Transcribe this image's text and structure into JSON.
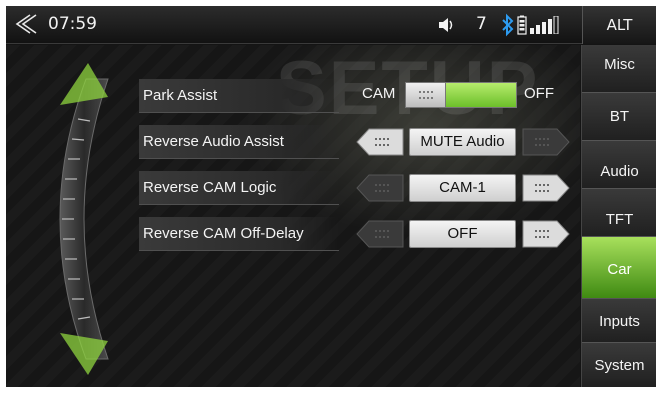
{
  "status_bar": {
    "clock": "07:59",
    "volume_level": "7",
    "alt_label": "ALT",
    "icons": [
      "back-icon",
      "volume-icon",
      "bluetooth-icon",
      "phone-battery-icon",
      "signal-strength-icon"
    ]
  },
  "main": {
    "watermark": "SETUP",
    "rows": [
      {
        "label": "Park Assist",
        "type": "toggle",
        "left_option": "CAM",
        "right_option": "OFF",
        "selected": "OFF"
      },
      {
        "label": "Reverse Audio Assist",
        "type": "selector",
        "value": "MUTE Audio",
        "prev_enabled": true,
        "next_enabled": false
      },
      {
        "label": "Reverse CAM Logic",
        "type": "selector",
        "value": "CAM-1",
        "prev_enabled": false,
        "next_enabled": true
      },
      {
        "label": "Reverse CAM Off-Delay",
        "type": "selector",
        "value": "OFF",
        "prev_enabled": false,
        "next_enabled": true
      }
    ]
  },
  "menu": {
    "items": [
      {
        "label": "Misc",
        "active": false
      },
      {
        "label": "BT",
        "active": false
      },
      {
        "label": "Audio",
        "active": false
      },
      {
        "label": "TFT",
        "active": false
      },
      {
        "label": "Car",
        "active": true
      },
      {
        "label": "Inputs",
        "active": false
      },
      {
        "label": "System",
        "active": false
      }
    ]
  },
  "colors": {
    "accent_green": "#8fd43f",
    "background": "#141414",
    "panel": "#2a2a2a"
  }
}
